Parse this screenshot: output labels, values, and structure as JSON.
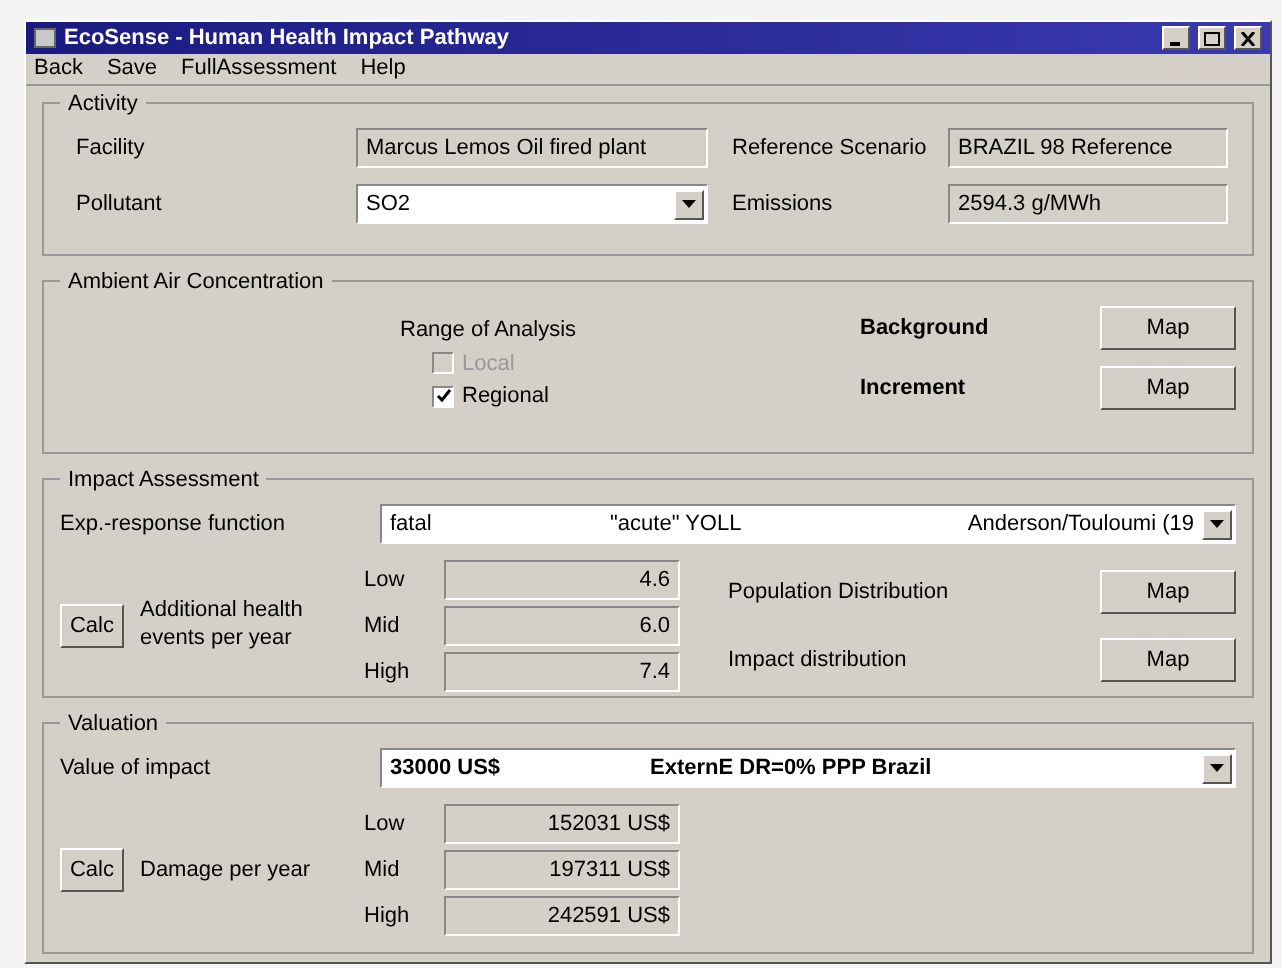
{
  "window": {
    "title": "EcoSense - Human Health Impact Pathway"
  },
  "menu": [
    "Back",
    "Save",
    "FullAssessment",
    "Help"
  ],
  "activity": {
    "title": "Activity",
    "facility_label": "Facility",
    "facility": "Marcus Lemos Oil fired plant",
    "pollutant_label": "Pollutant",
    "pollutant": "SO2",
    "scenario_label": "Reference Scenario",
    "scenario": "BRAZIL 98 Reference",
    "emissions_label": "Emissions",
    "emissions": "2594.3 g/MWh"
  },
  "ambient": {
    "title": "Ambient Air Concentration",
    "range_label": "Range of Analysis",
    "ranges": [
      {
        "label": "Local",
        "checked": false,
        "disabled": true
      },
      {
        "label": "Regional",
        "checked": true,
        "disabled": false
      }
    ],
    "maps": [
      {
        "label": "Background",
        "button": "Map"
      },
      {
        "label": "Increment",
        "button": "Map"
      }
    ]
  },
  "impact": {
    "title": "Impact Assessment",
    "function_label": "Exp.-response function",
    "function": [
      "fatal",
      "\"acute\" YOLL",
      "Anderson/Touloumi (19"
    ],
    "calc": "Calc",
    "result_label": "Additional health events per year",
    "results": [
      {
        "label": "Low",
        "value": "4.6"
      },
      {
        "label": "Mid",
        "value": "6.0"
      },
      {
        "label": "High",
        "value": "7.4"
      }
    ],
    "maps": [
      {
        "label": "Population Distribution",
        "button": "Map"
      },
      {
        "label": "Impact distribution",
        "button": "Map"
      }
    ]
  },
  "valuation": {
    "title": "Valuation",
    "value_label": "Value of impact",
    "value": [
      "33000 US$",
      "ExternE DR=0% PPP Brazil"
    ],
    "calc": "Calc",
    "result_label": "Damage per year",
    "results": [
      {
        "label": "Low",
        "value": "152031 US$"
      },
      {
        "label": "Mid",
        "value": "197311 US$"
      },
      {
        "label": "High",
        "value": "242591 US$"
      }
    ]
  }
}
